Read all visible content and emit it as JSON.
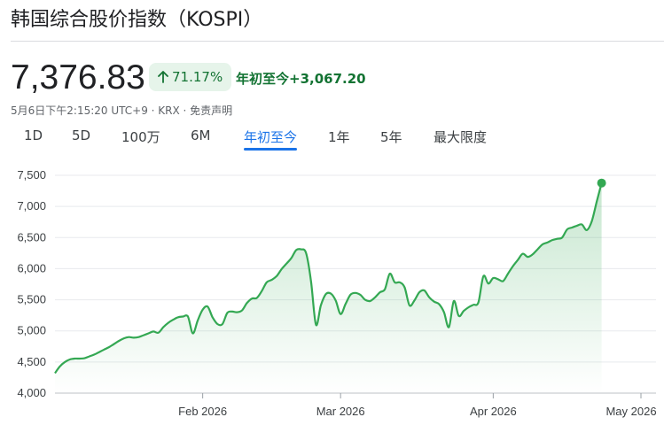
{
  "header": {
    "title": "韩国综合股价指数（KOSPI）",
    "price": "7,376.83",
    "change_percent": "71.17%",
    "change_arrow": "arrow-up-icon",
    "change_period_label": "年初至今",
    "change_value": "+3,067.20",
    "meta": "5月6日下午2:15:20 UTC+9 · KRX · 免责声明"
  },
  "tabs": [
    {
      "label": "1D"
    },
    {
      "label": "5D"
    },
    {
      "label": "100万"
    },
    {
      "label": "6M"
    },
    {
      "label": "年初至今",
      "active": true
    },
    {
      "label": "1年"
    },
    {
      "label": "5年"
    },
    {
      "label": "最大限度"
    }
  ],
  "colors": {
    "accent": "#1a73e8",
    "positive": "#137333",
    "line": "#34a853",
    "badge_bg": "#e6f4ea"
  },
  "chart_data": {
    "type": "area",
    "title": "",
    "xlabel": "",
    "ylabel": "",
    "ylim": [
      4000,
      7500
    ],
    "yticks": [
      "4,000",
      "4,500",
      "5,000",
      "5,500",
      "6,000",
      "6,500",
      "7,000",
      "7,500"
    ],
    "xticks": [
      {
        "label": "Feb 2026",
        "value": 31
      },
      {
        "label": "Mar 2026",
        "value": 59
      },
      {
        "label": "Apr 2026",
        "value": 90
      },
      {
        "label": "May 2026",
        "value": 120
      }
    ],
    "grid": true,
    "x_unit": "days since start of year",
    "series": [
      {
        "points": [
          [
            1,
            4320
          ],
          [
            2,
            4430
          ],
          [
            3,
            4500
          ],
          [
            4,
            4540
          ],
          [
            5,
            4555
          ],
          [
            6,
            4555
          ],
          [
            7,
            4560
          ],
          [
            8,
            4590
          ],
          [
            9,
            4620
          ],
          [
            10,
            4660
          ],
          [
            11,
            4700
          ],
          [
            12,
            4740
          ],
          [
            13,
            4790
          ],
          [
            14,
            4840
          ],
          [
            15,
            4880
          ],
          [
            16,
            4900
          ],
          [
            17,
            4890
          ],
          [
            18,
            4900
          ],
          [
            19,
            4930
          ],
          [
            20,
            4960
          ],
          [
            21,
            4990
          ],
          [
            22,
            4970
          ],
          [
            23,
            5060
          ],
          [
            24,
            5130
          ],
          [
            25,
            5180
          ],
          [
            26,
            5220
          ],
          [
            27,
            5230
          ],
          [
            28,
            5230
          ],
          [
            29,
            4960
          ],
          [
            30,
            5170
          ],
          [
            31,
            5340
          ],
          [
            32,
            5390
          ],
          [
            33,
            5220
          ],
          [
            34,
            5110
          ],
          [
            35,
            5110
          ],
          [
            36,
            5290
          ],
          [
            37,
            5310
          ],
          [
            38,
            5300
          ],
          [
            39,
            5330
          ],
          [
            40,
            5450
          ],
          [
            41,
            5520
          ],
          [
            42,
            5530
          ],
          [
            43,
            5640
          ],
          [
            44,
            5780
          ],
          [
            45,
            5820
          ],
          [
            46,
            5880
          ],
          [
            47,
            5990
          ],
          [
            48,
            6080
          ],
          [
            49,
            6170
          ],
          [
            50,
            6300
          ],
          [
            51,
            6310
          ],
          [
            52,
            6250
          ],
          [
            53,
            5800
          ],
          [
            54,
            5100
          ],
          [
            55,
            5410
          ],
          [
            56,
            5590
          ],
          [
            57,
            5600
          ],
          [
            58,
            5490
          ],
          [
            59,
            5270
          ],
          [
            60,
            5430
          ],
          [
            61,
            5580
          ],
          [
            62,
            5610
          ],
          [
            63,
            5580
          ],
          [
            64,
            5500
          ],
          [
            65,
            5480
          ],
          [
            66,
            5540
          ],
          [
            67,
            5620
          ],
          [
            68,
            5670
          ],
          [
            69,
            5920
          ],
          [
            70,
            5780
          ],
          [
            71,
            5780
          ],
          [
            72,
            5700
          ],
          [
            73,
            5410
          ],
          [
            74,
            5490
          ],
          [
            75,
            5620
          ],
          [
            76,
            5650
          ],
          [
            77,
            5540
          ],
          [
            78,
            5470
          ],
          [
            79,
            5430
          ],
          [
            80,
            5300
          ],
          [
            81,
            5060
          ],
          [
            82,
            5480
          ],
          [
            83,
            5240
          ],
          [
            84,
            5320
          ],
          [
            85,
            5380
          ],
          [
            86,
            5420
          ],
          [
            87,
            5460
          ],
          [
            88,
            5880
          ],
          [
            89,
            5760
          ],
          [
            90,
            5850
          ],
          [
            91,
            5830
          ],
          [
            92,
            5800
          ],
          [
            93,
            5920
          ],
          [
            94,
            6040
          ],
          [
            95,
            6140
          ],
          [
            96,
            6240
          ],
          [
            97,
            6190
          ],
          [
            98,
            6230
          ],
          [
            99,
            6310
          ],
          [
            100,
            6390
          ],
          [
            101,
            6420
          ],
          [
            102,
            6460
          ],
          [
            103,
            6480
          ],
          [
            104,
            6500
          ],
          [
            105,
            6630
          ],
          [
            106,
            6660
          ],
          [
            107,
            6690
          ],
          [
            108,
            6710
          ],
          [
            109,
            6620
          ],
          [
            110,
            6760
          ],
          [
            111,
            7070
          ],
          [
            112,
            7376.83
          ]
        ]
      }
    ]
  }
}
